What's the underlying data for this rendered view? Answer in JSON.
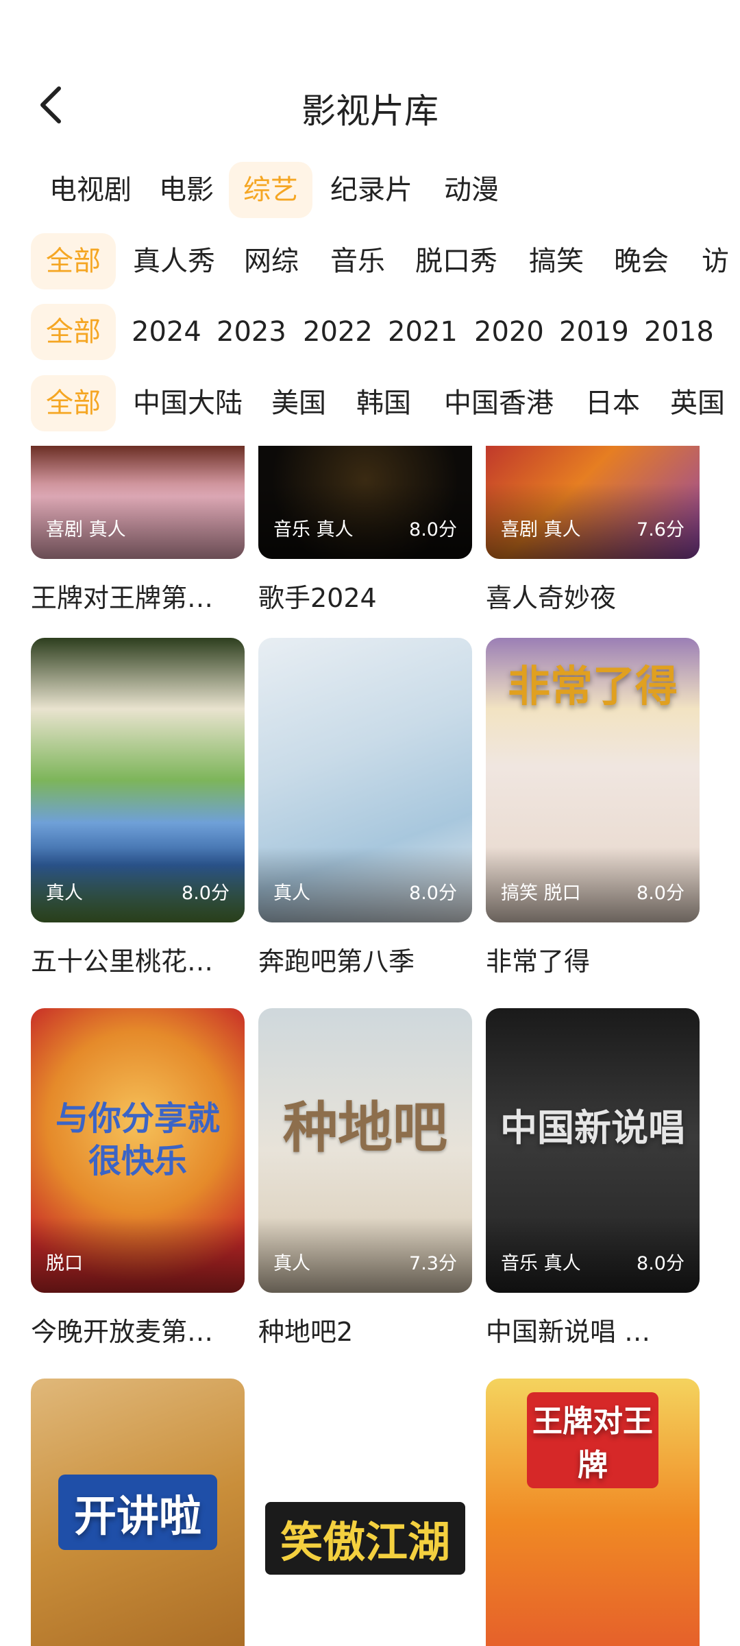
{
  "header": {
    "title": "影视片库"
  },
  "filters": {
    "type": [
      "电视剧",
      "电影",
      "综艺",
      "纪录片",
      "动漫"
    ],
    "genre": [
      "全部",
      "真人秀",
      "网综",
      "音乐",
      "脱口秀",
      "搞笑",
      "晚会",
      "访"
    ],
    "year": [
      "全部",
      "2024",
      "2023",
      "2022",
      "2021",
      "2020",
      "2019",
      "2018"
    ],
    "region": [
      "全部",
      "中国大陆",
      "美国",
      "韩国",
      "中国香港",
      "日本",
      "英国"
    ]
  },
  "colors": {
    "accent": "#f5a623",
    "chip_bg": "#fff4e6"
  },
  "items": [
    {
      "title": "王牌对王牌第…",
      "tags": "喜剧 真人",
      "score": "",
      "art": ""
    },
    {
      "title": "歌手2024",
      "tags": "音乐 真人",
      "score": "8.0分",
      "art": ""
    },
    {
      "title": "喜人奇妙夜",
      "tags": "喜剧 真人",
      "score": "7.6分",
      "art": ""
    },
    {
      "title": "五十公里桃花…",
      "tags": "真人",
      "score": "8.0分",
      "art": ""
    },
    {
      "title": "奔跑吧第八季",
      "tags": "真人",
      "score": "8.0分",
      "art": ""
    },
    {
      "title": "非常了得",
      "tags": "搞笑 脱口",
      "score": "8.0分",
      "art": "非常了得"
    },
    {
      "title": "今晚开放麦第…",
      "tags": "脱口",
      "score": "",
      "art": "与你分享就很快乐"
    },
    {
      "title": "种地吧2",
      "tags": "真人",
      "score": "7.3分",
      "art": "种地吧"
    },
    {
      "title": "中国新说唱 …",
      "tags": "音乐 真人",
      "score": "8.0分",
      "art": "中国新说唱"
    },
    {
      "title": "",
      "tags": "",
      "score": "",
      "art": "开讲啦"
    },
    {
      "title": "",
      "tags": "",
      "score": "",
      "art": "笑傲江湖"
    },
    {
      "title": "",
      "tags": "",
      "score": "",
      "art": "王牌对王牌"
    }
  ]
}
